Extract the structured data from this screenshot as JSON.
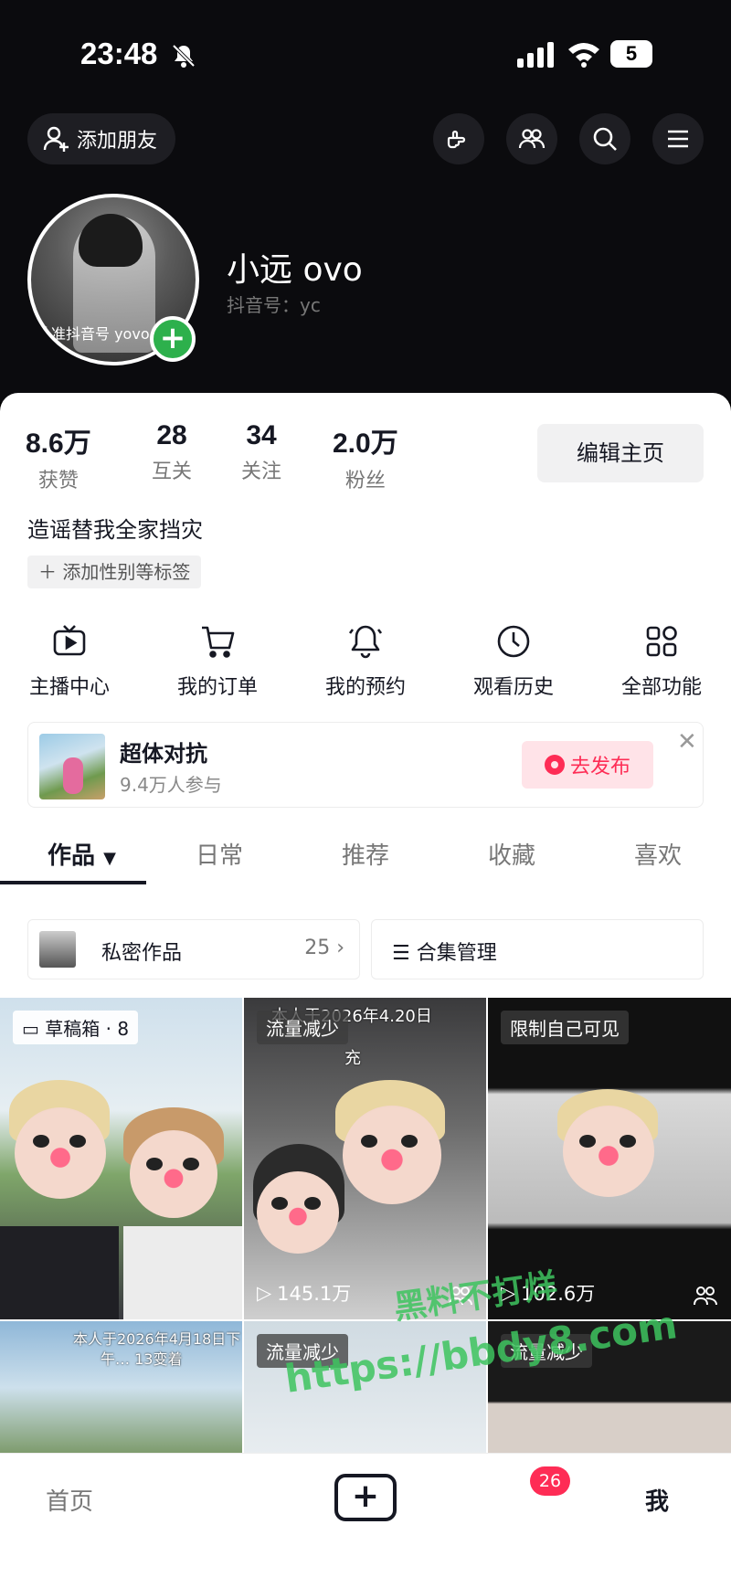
{
  "status_bar": {
    "time": "23:48",
    "battery": "5"
  },
  "header": {
    "add_friend": "添加朋友"
  },
  "profile": {
    "nickname": "小远 ovo",
    "douyin_id": "抖音号：yc",
    "avatar_watermark": "认准抖音号 yovo"
  },
  "stats": [
    {
      "num": "8.6万",
      "label": "获赞"
    },
    {
      "num": "28",
      "label": "互关"
    },
    {
      "num": "34",
      "label": "关注"
    },
    {
      "num": "2.0万",
      "label": "粉丝"
    }
  ],
  "edit_profile": "编辑主页",
  "bio": "造谣替我全家挡灾",
  "add_tag": "添加性别等标签",
  "functions": [
    {
      "label": "主播中心",
      "icon": "tv-icon"
    },
    {
      "label": "我的订单",
      "icon": "cart-icon"
    },
    {
      "label": "我的预约",
      "icon": "bell-icon"
    },
    {
      "label": "观看历史",
      "icon": "clock-icon"
    },
    {
      "label": "全部功能",
      "icon": "grid-icon"
    }
  ],
  "banner": {
    "title": "超体对抗",
    "subtitle": "9.4万人参与",
    "button": "去发布"
  },
  "tabs": [
    "作品",
    "日常",
    "推荐",
    "收藏",
    "喜欢"
  ],
  "private_works": {
    "label": "私密作品",
    "count": "25 ›"
  },
  "collection_manage": "合集管理",
  "grid": [
    {
      "label": "草稿箱 · 8"
    },
    {
      "label": "流量减少",
      "overlay": "本人于2026年4.20日",
      "overlay2": "充",
      "plays": "145.1万"
    },
    {
      "label": "限制自己可见",
      "plays": "102.6万"
    },
    {
      "overlay": "本人于2026年4月18日下",
      "overlay2": "午… 13变着"
    },
    {
      "label": "流量减少"
    },
    {
      "label": "流量减少"
    }
  ],
  "bottom_nav": {
    "home": "首页",
    "badge": "26",
    "me": "我"
  },
  "watermark": {
    "line1": "黑料不打烊",
    "line2": "https://bbdy8.com"
  },
  "colors": {
    "accent": "#fe2c55",
    "green": "#2db04c",
    "dark": "#0b0b0e"
  }
}
